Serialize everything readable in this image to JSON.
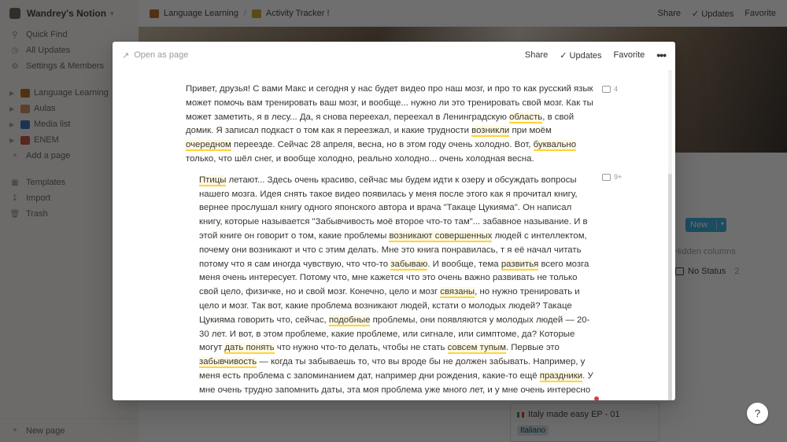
{
  "sidebar": {
    "workspace": "Wandrey's Notion",
    "quick_find": "Quick Find",
    "all_updates": "All Updates",
    "settings": "Settings & Members",
    "pages": [
      {
        "label": "Language Learning",
        "color": "#b5651d"
      },
      {
        "label": "Aulas",
        "color": "#d08a5a"
      },
      {
        "label": "Media list",
        "color": "#2f6fb5"
      },
      {
        "label": "ENEM",
        "color": "#c94a3b"
      }
    ],
    "add_page": "Add a page",
    "templates": "Templates",
    "import": "Import",
    "trash": "Trash",
    "new_page": "New page"
  },
  "topbar": {
    "crumb1": "Language Learning",
    "crumb2": "Activity Tracker !",
    "share": "Share",
    "updates": "Updates",
    "favorite": "Favorite"
  },
  "board": {
    "new_label": "New",
    "hidden_columns": "Hidden columns",
    "no_status": "No Status",
    "no_status_count": "2",
    "card_title": "Italy made easy EP - 01",
    "card_tag": "Italiano"
  },
  "modal": {
    "open_as_page": "Open as page",
    "share": "Share",
    "updates": "Updates",
    "favorite": "Favorite",
    "comment_count_1": "4",
    "comment_count_2": "9+",
    "p1": [
      "Привет, друзья! С вами Макс и сегодня у нас будет видео про наш мозг, и про то как русский язык может помочь вам тренировать ваш мозг, и вообще... нужно ли это тренировать свой мозг.  Как ты может заметить, я в лесу... Да, я снова переехал, переехал в Ленинградскую ",
      "область",
      ", в свой домик. Я записал подкаст о том как я переезжал, и какие трудности ",
      "возникли",
      " при моём ",
      "очередном",
      " переезде. Сейчас 28 апреля, весна, но в этом году очень холодно. Вот, ",
      "буквально",
      " только, что шёл снег, и вообще холодно, реально холодно... очень холодная весна."
    ],
    "p2": [
      "Птицы",
      " летают... Здесь очень красиво, сейчас мы будем идти к озеру и обсуждать вопросы нашего мозга. Идея снять такое видео появилась у меня после этого как я прочитал книгу, вернее прослушал книгу одного японского автора и врача \"Такаце Цукияма\". Он написал книгу, которые называется \"Забывчивость моё второе что-то там\"... забавное называние. И в этой книге он говорит о том, какие проблемы ",
      "возникают совершенных",
      " людей с интеллектом, почему они возникают и что с этим делать. Мне это книга понравилась, т я её начал читать потому что я сам иногда чувствую, что что-то ",
      "забываю",
      ". И вообще, тема ",
      "развитья",
      " всего мозга меня очень интересует. Потому что, мне кажется что это очень важно развивать не только свой цело, физичке, но и свой мозг. Конечно, цело и мозг ",
      "связаны",
      ", но нужно тренировать и цело и мозг. Так вот, какие проблема возникают людей, кстати о молодых людей? Такаце Цукияма говорить что, сейчас, ",
      "подобные",
      " проблемы, они появляются у молодых людей — 20-30 лет. И вот, в этом проблеме, какие проблеме, или сигнале, или симптоме, да? Которые могут ",
      "дать понять",
      " что нужно что-то делать, чтобы не стать ",
      "совсем тупым",
      ". Первые это ",
      "забывчивость",
      " — когда ты забываешь то, что вы вроде бы не должен забывать. Например, у меня есть проблема с запоминанием дат, например дни рождения, какие-то ещё ",
      "праздники",
      ". У мне очень трудно запомнить даты, эта моя проблема уже много лет, и у мне очень интересно что можно с этим делать. Вторая проблема это"
    ]
  }
}
